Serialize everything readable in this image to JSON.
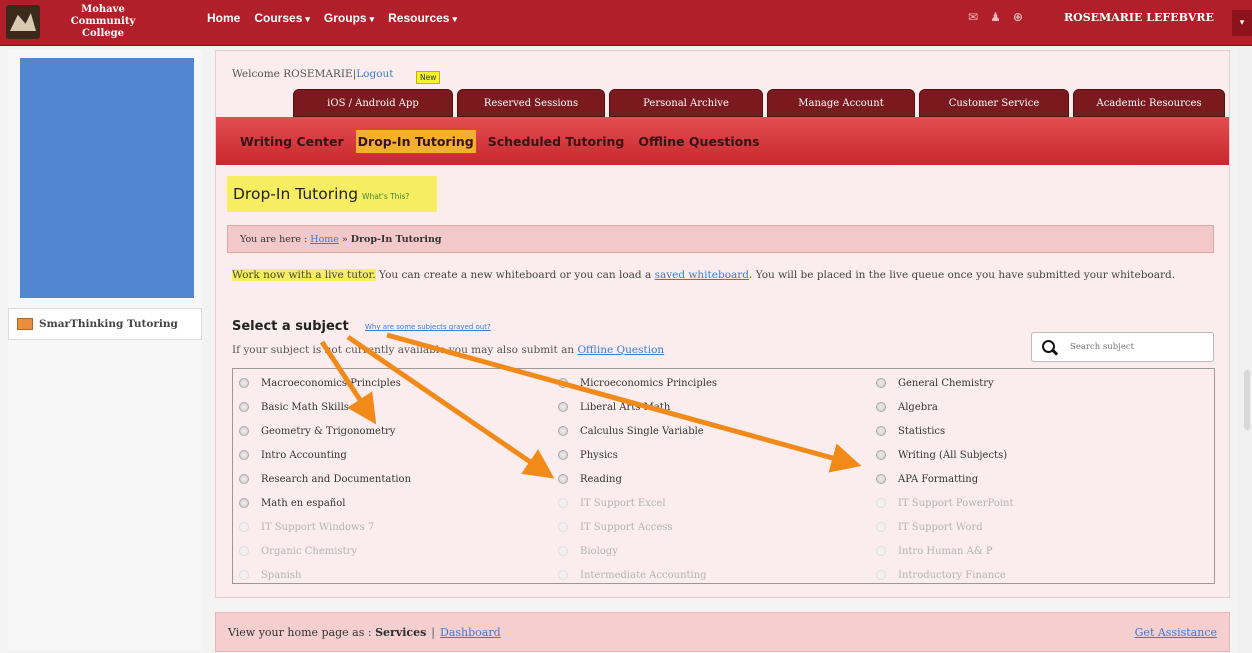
{
  "header": {
    "logo_text": "Mohave Community College",
    "nav": [
      {
        "label": "Home",
        "caret": ""
      },
      {
        "label": "Courses",
        "caret": "▾"
      },
      {
        "label": "Groups",
        "caret": "▾"
      },
      {
        "label": "Resources",
        "caret": "▾"
      }
    ],
    "icons": [
      "mail-icon",
      "people-icon",
      "globe-icon"
    ],
    "user_name": "ROSEMARIE LEFEBVRE",
    "user_caret": "▾"
  },
  "sidebar": {
    "tab_label": "SmarThinking Tutoring"
  },
  "main": {
    "welcome_prefix": "Welcome ROSEMARIE",
    "logout_sep": "|",
    "logout_label": "Logout",
    "new_badge": "New",
    "tabs": [
      "iOS / Android App",
      "Reserved Sessions",
      "Personal Archive",
      "Manage Account",
      "Customer Service",
      "Academic Resources"
    ],
    "subnav": [
      "Writing Center",
      "Drop-In Tutoring",
      "Scheduled Tutoring",
      "Offline Questions"
    ],
    "title": "Drop-In Tutoring",
    "whats_this": "What's This?",
    "breadcrumb": {
      "prefix": "You are here :",
      "home": "Home",
      "sep": "»",
      "current": "Drop-In Tutoring"
    },
    "intro": {
      "highlight": "Work now with a live tutor.",
      "text1": " You can create a new whiteboard or you can load a ",
      "link": "saved whiteboard",
      "text2": ". You will be placed in the live queue once you have submitted your whiteboard."
    },
    "select_title": "Select a subject",
    "why_link": "Why are some subjects grayed out?",
    "offline_prefix": "If your subject is not currently available you may also submit an ",
    "offline_link": "Offline Question",
    "search_placeholder": "Search subject",
    "subjects_col1": [
      {
        "label": "Macroeconomics Principles",
        "enabled": true
      },
      {
        "label": "Basic Math Skills",
        "enabled": true
      },
      {
        "label": "Geometry & Trigonometry",
        "enabled": true
      },
      {
        "label": "Intro Accounting",
        "enabled": true
      },
      {
        "label": "Research and Documentation",
        "enabled": true
      },
      {
        "label": "Math en español",
        "enabled": true
      },
      {
        "label": "IT Support Windows 7",
        "enabled": false
      },
      {
        "label": "Organic Chemistry",
        "enabled": false
      },
      {
        "label": "Spanish",
        "enabled": false
      }
    ],
    "subjects_col2": [
      {
        "label": "Microeconomics Principles",
        "enabled": true
      },
      {
        "label": "Liberal Arts Math",
        "enabled": true
      },
      {
        "label": "Calculus Single Variable",
        "enabled": true
      },
      {
        "label": "Physics",
        "enabled": true
      },
      {
        "label": "Reading",
        "enabled": true
      },
      {
        "label": "IT Support Excel",
        "enabled": false
      },
      {
        "label": "IT Support Access",
        "enabled": false
      },
      {
        "label": "Biology",
        "enabled": false
      },
      {
        "label": "Intermediate Accounting",
        "enabled": false
      }
    ],
    "subjects_col3": [
      {
        "label": "General Chemistry",
        "enabled": true
      },
      {
        "label": "Algebra",
        "enabled": true
      },
      {
        "label": "Statistics",
        "enabled": true
      },
      {
        "label": "Writing (All Subjects)",
        "enabled": true
      },
      {
        "label": "APA Formatting",
        "enabled": true
      },
      {
        "label": "IT Support PowerPoint",
        "enabled": false
      },
      {
        "label": "IT Support Word",
        "enabled": false
      },
      {
        "label": "Intro Human A& P",
        "enabled": false
      },
      {
        "label": "Introductory Finance",
        "enabled": false
      }
    ]
  },
  "footer": {
    "prefix": "View your home page as :",
    "services": "Services",
    "sep": "|",
    "dashboard": "Dashboard",
    "help": "Get Assistance"
  },
  "colors": {
    "topbar": "#b01f2a",
    "tab": "#7a1a1f",
    "highlight": "#f6ee60",
    "active_subnav": "#f1b02d",
    "arrow": "#f28a1a"
  }
}
